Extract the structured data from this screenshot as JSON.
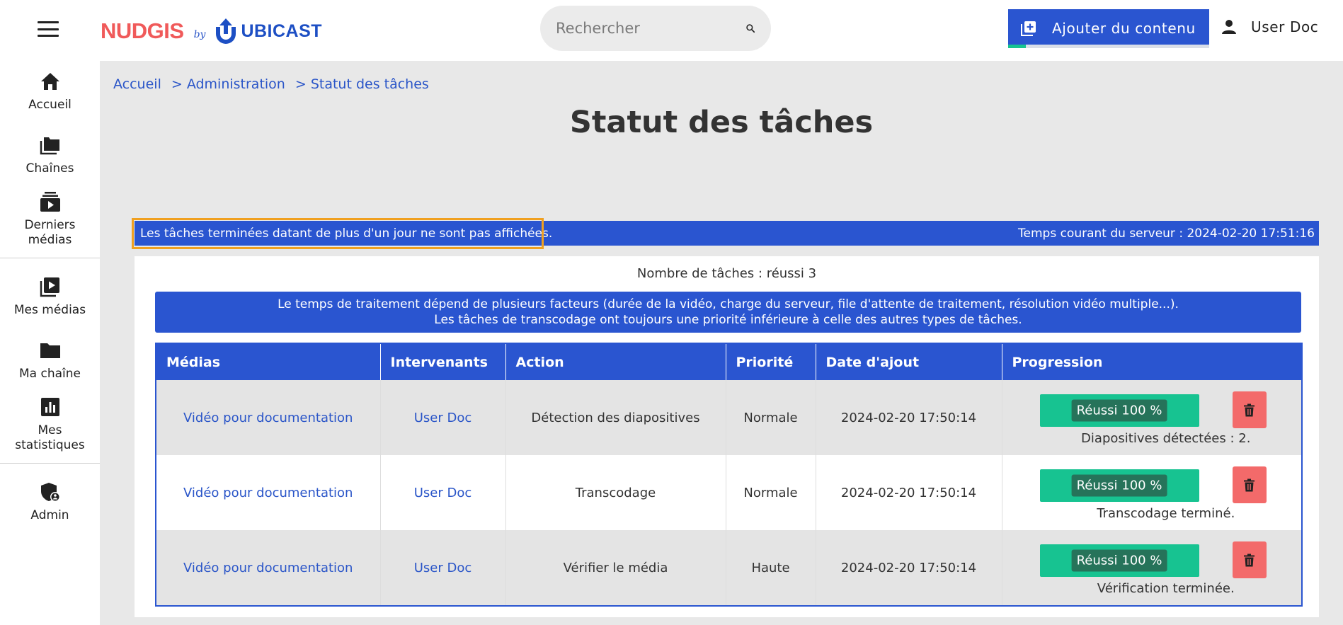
{
  "header": {
    "logo_nudgis": "NUDGIS",
    "logo_by": "by",
    "logo_ubicast": "UBICAST",
    "search_placeholder": "Rechercher",
    "add_content_label": "Ajouter du contenu",
    "user_name": "User Doc"
  },
  "sidebar": {
    "items": [
      {
        "label": "Accueil",
        "icon": "home-icon"
      },
      {
        "label": "Chaînes",
        "icon": "channels-icon"
      },
      {
        "label": "Derniers médias",
        "icon": "latest-media-icon"
      },
      {
        "label": "Mes médias",
        "icon": "my-media-icon"
      },
      {
        "label": "Ma chaîne",
        "icon": "folder-icon"
      },
      {
        "label": "Mes statistiques",
        "icon": "stats-icon"
      },
      {
        "label": "Admin",
        "icon": "admin-shield-icon"
      }
    ]
  },
  "breadcrumb": [
    {
      "label": "Accueil"
    },
    {
      "label": "> Administration"
    },
    {
      "label": "> Statut des tâches"
    }
  ],
  "page_title": "Statut des tâches",
  "info_bar": {
    "left": "Les tâches terminées datant de plus d'un jour ne sont pas affichées.",
    "right": "Temps courant du serveur : 2024-02-20 17:51:16"
  },
  "task_count": "Nombre de tâches : réussi 3",
  "notice": {
    "line1": "Le temps de traitement dépend de plusieurs facteurs (durée de la vidéo, charge du serveur, file d'attente de traitement, résolution vidéo multiple...).",
    "line2": "Les tâches de transcodage ont toujours une priorité inférieure à celle des autres types de tâches."
  },
  "table": {
    "headers": [
      "Médias",
      "Intervenants",
      "Action",
      "Priorité",
      "Date d'ajout",
      "Progression"
    ],
    "rows": [
      {
        "media": "Vidéo pour documentation",
        "speaker": "User Doc",
        "action": "Détection des diapositives",
        "priority": "Normale",
        "date": "2024-02-20 17:50:14",
        "progress_label": "Réussi 100 %",
        "progress": 100,
        "message": "Diapositives détectées : 2."
      },
      {
        "media": "Vidéo pour documentation",
        "speaker": "User Doc",
        "action": "Transcodage",
        "priority": "Normale",
        "date": "2024-02-20 17:50:14",
        "progress_label": "Réussi 100 %",
        "progress": 100,
        "message": "Transcodage terminé."
      },
      {
        "media": "Vidéo pour documentation",
        "speaker": "User Doc",
        "action": "Vérifier le média",
        "priority": "Haute",
        "date": "2024-02-20 17:50:14",
        "progress_label": "Réussi 100 %",
        "progress": 100,
        "message": "Vérification terminée."
      }
    ]
  },
  "colors": {
    "primary": "#2a55d0",
    "success": "#17c391",
    "danger": "#f36a6a",
    "logo_red": "#f05a5a",
    "highlight": "#f0a020"
  }
}
